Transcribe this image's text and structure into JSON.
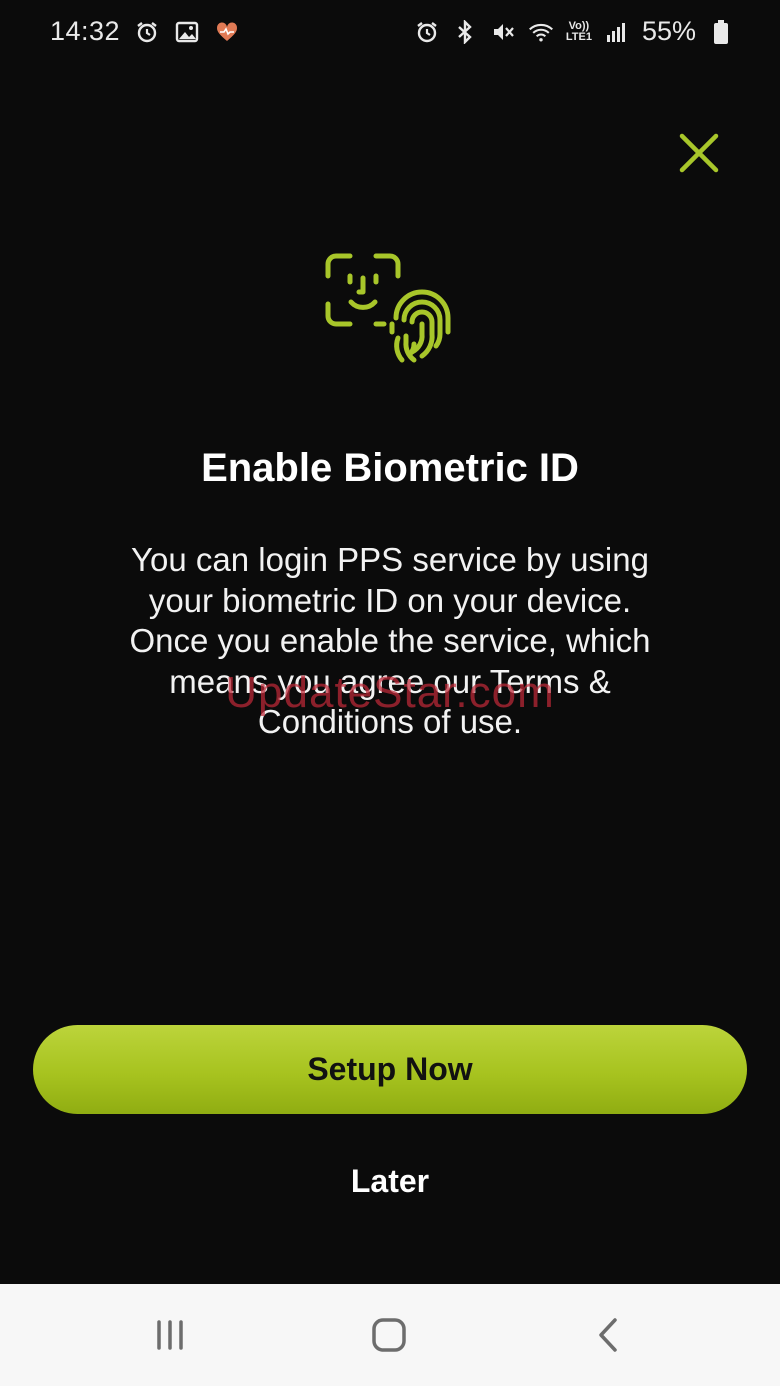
{
  "status_bar": {
    "time": "14:32",
    "left_icons": [
      "alarm-icon",
      "gallery-icon",
      "health-icon"
    ],
    "right_icons": [
      "alarm-icon",
      "bluetooth-icon",
      "mute-icon",
      "wifi-icon",
      "volte-icon",
      "signal-icon"
    ],
    "volte_label_top": "Vo))",
    "volte_label_bottom": "LTE1",
    "battery_percent": "55%"
  },
  "dialog": {
    "close_icon": "close-icon",
    "hero_icon": "face-fingerprint-icon",
    "title": "Enable Biometric ID",
    "description": "You can login PPS service by using your biometric ID on your device. Once you enable the service, which means you agree our Terms & Conditions of use.",
    "primary_button": "Setup Now",
    "secondary_button": "Later"
  },
  "watermark": "UpdateStar.com",
  "nav_bar": {
    "buttons": [
      "recent-apps-icon",
      "home-icon",
      "back-icon"
    ]
  },
  "colors": {
    "accent": "#a8c62a",
    "background": "#0b0b0b",
    "button_text": "#111111"
  }
}
